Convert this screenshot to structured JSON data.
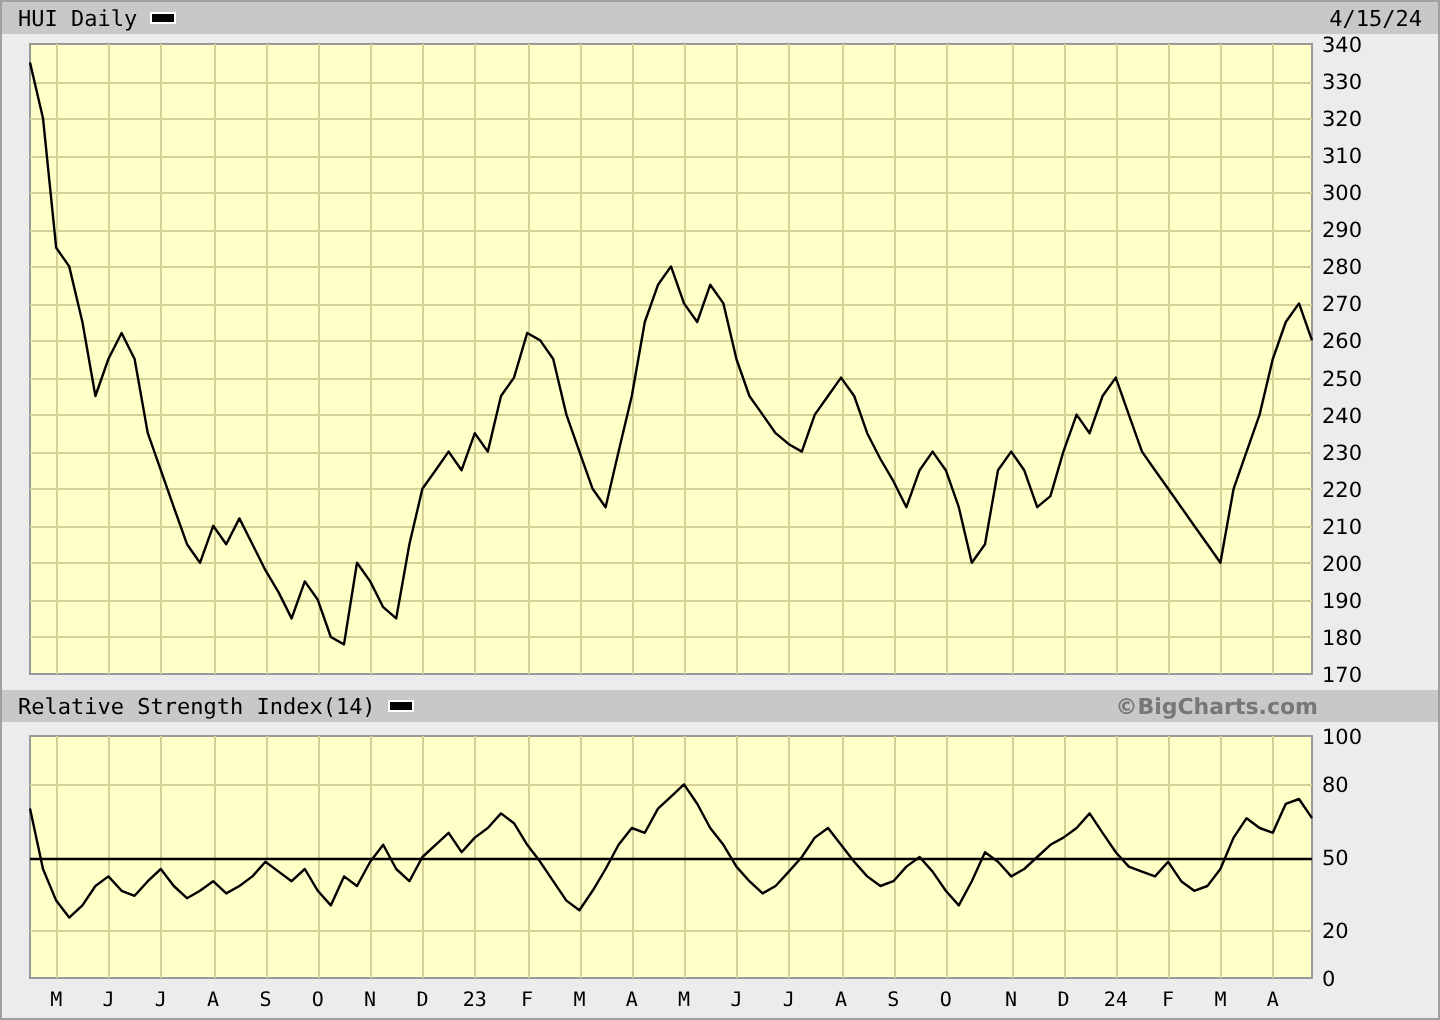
{
  "charts": [
    {
      "date": "4/15/24",
      "chart_data": {
        "type": "line",
        "title": "HUI Daily",
        "grid": true,
        "ylim": [
          170,
          340
        ],
        "yticks": [
          170,
          180,
          190,
          200,
          210,
          220,
          230,
          240,
          250,
          260,
          270,
          280,
          290,
          300,
          310,
          320,
          330,
          340
        ],
        "series": [
          {
            "color": "#000000",
            "values": [
              335,
              320,
              285,
              280,
              265,
              245,
              255,
              262,
              255,
              235,
              225,
              215,
              205,
              200,
              210,
              205,
              212,
              205,
              198,
              192,
              185,
              195,
              190,
              180,
              178,
              200,
              195,
              188,
              185,
              205,
              220,
              225,
              230,
              225,
              235,
              230,
              245,
              250,
              262,
              260,
              255,
              240,
              230,
              220,
              215,
              230,
              245,
              265,
              275,
              280,
              270,
              265,
              275,
              270,
              255,
              245,
              240,
              235,
              232,
              230,
              240,
              245,
              250,
              245,
              235,
              228,
              222,
              215,
              225,
              230,
              225,
              215,
              200,
              205,
              225,
              230,
              225,
              215,
              218,
              230,
              240,
              235,
              245,
              250,
              240,
              230,
              225,
              220,
              215,
              210,
              205,
              200,
              220,
              230,
              240,
              255,
              265,
              270,
              260
            ]
          }
        ]
      }
    },
    {
      "credit": "©BigCharts.com",
      "chart_data": {
        "type": "line",
        "title": "Relative Strength Index(14)",
        "grid": true,
        "ylim": [
          0,
          100
        ],
        "yticks": [
          0,
          20,
          50,
          80,
          100
        ],
        "categories": [
          null,
          null,
          "M",
          null,
          null,
          null,
          "J",
          null,
          null,
          null,
          "J",
          null,
          null,
          null,
          "A",
          null,
          null,
          null,
          "S",
          null,
          null,
          null,
          "O",
          null,
          null,
          null,
          "N",
          null,
          null,
          null,
          "D",
          null,
          null,
          null,
          "23",
          null,
          null,
          null,
          "F",
          null,
          null,
          null,
          "M",
          null,
          null,
          null,
          "A",
          null,
          null,
          null,
          "M",
          null,
          null,
          null,
          "J",
          null,
          null,
          null,
          "J",
          null,
          null,
          null,
          "A",
          null,
          null,
          null,
          "S",
          null,
          null,
          null,
          "O",
          null,
          null,
          null,
          null,
          "N",
          null,
          null,
          null,
          "D",
          null,
          null,
          null,
          "24",
          null,
          null,
          null,
          "F",
          null,
          null,
          null,
          "M",
          null,
          null,
          null,
          "A",
          null,
          null,
          null
        ],
        "series": [
          {
            "color": "#000000",
            "values": [
              70,
              45,
              32,
              25,
              30,
              38,
              42,
              36,
              34,
              40,
              45,
              38,
              33,
              36,
              40,
              35,
              38,
              42,
              48,
              44,
              40,
              45,
              36,
              30,
              42,
              38,
              48,
              55,
              45,
              40,
              50,
              55,
              60,
              52,
              58,
              62,
              68,
              64,
              55,
              48,
              40,
              32,
              28,
              36,
              45,
              55,
              62,
              60,
              70,
              75,
              80,
              72,
              62,
              55,
              46,
              40,
              35,
              38,
              44,
              50,
              58,
              62,
              55,
              48,
              42,
              38,
              40,
              46,
              50,
              44,
              36,
              30,
              40,
              52,
              48,
              42,
              45,
              50,
              55,
              58,
              62,
              68,
              60,
              52,
              46,
              44,
              42,
              48,
              40,
              36,
              38,
              45,
              58,
              66,
              62,
              60,
              72,
              74,
              66
            ]
          }
        ],
        "ref_lines": [
          {
            "axis": "y",
            "value": 50
          }
        ]
      }
    }
  ]
}
